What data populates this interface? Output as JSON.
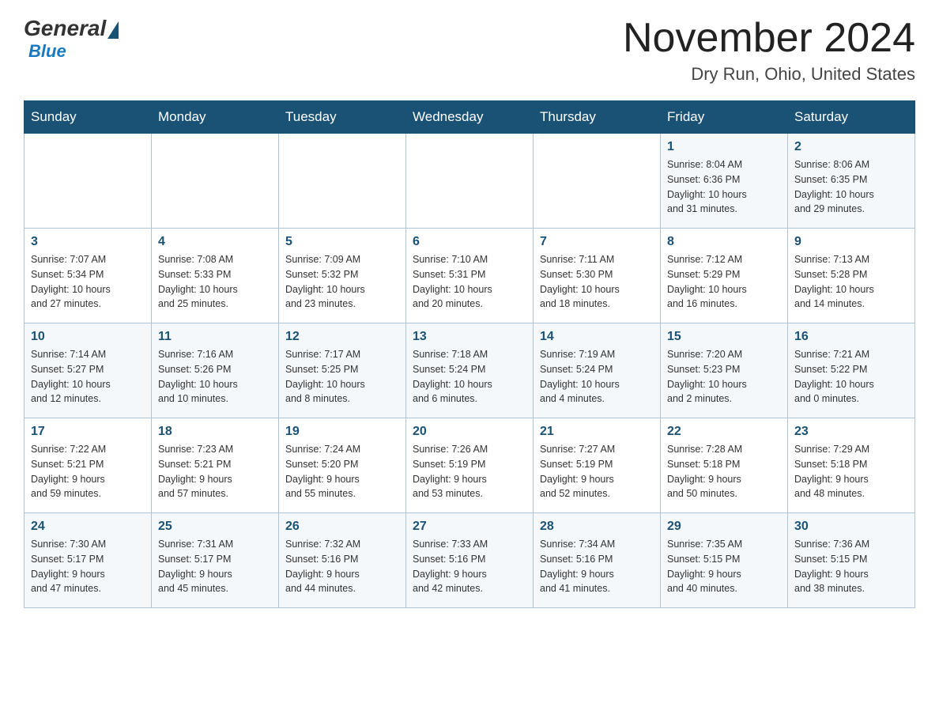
{
  "logo": {
    "general": "General",
    "blue": "Blue"
  },
  "header": {
    "title": "November 2024",
    "location": "Dry Run, Ohio, United States"
  },
  "days_of_week": [
    "Sunday",
    "Monday",
    "Tuesday",
    "Wednesday",
    "Thursday",
    "Friday",
    "Saturday"
  ],
  "weeks": [
    [
      {
        "day": "",
        "info": ""
      },
      {
        "day": "",
        "info": ""
      },
      {
        "day": "",
        "info": ""
      },
      {
        "day": "",
        "info": ""
      },
      {
        "day": "",
        "info": ""
      },
      {
        "day": "1",
        "info": "Sunrise: 8:04 AM\nSunset: 6:36 PM\nDaylight: 10 hours\nand 31 minutes."
      },
      {
        "day": "2",
        "info": "Sunrise: 8:06 AM\nSunset: 6:35 PM\nDaylight: 10 hours\nand 29 minutes."
      }
    ],
    [
      {
        "day": "3",
        "info": "Sunrise: 7:07 AM\nSunset: 5:34 PM\nDaylight: 10 hours\nand 27 minutes."
      },
      {
        "day": "4",
        "info": "Sunrise: 7:08 AM\nSunset: 5:33 PM\nDaylight: 10 hours\nand 25 minutes."
      },
      {
        "day": "5",
        "info": "Sunrise: 7:09 AM\nSunset: 5:32 PM\nDaylight: 10 hours\nand 23 minutes."
      },
      {
        "day": "6",
        "info": "Sunrise: 7:10 AM\nSunset: 5:31 PM\nDaylight: 10 hours\nand 20 minutes."
      },
      {
        "day": "7",
        "info": "Sunrise: 7:11 AM\nSunset: 5:30 PM\nDaylight: 10 hours\nand 18 minutes."
      },
      {
        "day": "8",
        "info": "Sunrise: 7:12 AM\nSunset: 5:29 PM\nDaylight: 10 hours\nand 16 minutes."
      },
      {
        "day": "9",
        "info": "Sunrise: 7:13 AM\nSunset: 5:28 PM\nDaylight: 10 hours\nand 14 minutes."
      }
    ],
    [
      {
        "day": "10",
        "info": "Sunrise: 7:14 AM\nSunset: 5:27 PM\nDaylight: 10 hours\nand 12 minutes."
      },
      {
        "day": "11",
        "info": "Sunrise: 7:16 AM\nSunset: 5:26 PM\nDaylight: 10 hours\nand 10 minutes."
      },
      {
        "day": "12",
        "info": "Sunrise: 7:17 AM\nSunset: 5:25 PM\nDaylight: 10 hours\nand 8 minutes."
      },
      {
        "day": "13",
        "info": "Sunrise: 7:18 AM\nSunset: 5:24 PM\nDaylight: 10 hours\nand 6 minutes."
      },
      {
        "day": "14",
        "info": "Sunrise: 7:19 AM\nSunset: 5:24 PM\nDaylight: 10 hours\nand 4 minutes."
      },
      {
        "day": "15",
        "info": "Sunrise: 7:20 AM\nSunset: 5:23 PM\nDaylight: 10 hours\nand 2 minutes."
      },
      {
        "day": "16",
        "info": "Sunrise: 7:21 AM\nSunset: 5:22 PM\nDaylight: 10 hours\nand 0 minutes."
      }
    ],
    [
      {
        "day": "17",
        "info": "Sunrise: 7:22 AM\nSunset: 5:21 PM\nDaylight: 9 hours\nand 59 minutes."
      },
      {
        "day": "18",
        "info": "Sunrise: 7:23 AM\nSunset: 5:21 PM\nDaylight: 9 hours\nand 57 minutes."
      },
      {
        "day": "19",
        "info": "Sunrise: 7:24 AM\nSunset: 5:20 PM\nDaylight: 9 hours\nand 55 minutes."
      },
      {
        "day": "20",
        "info": "Sunrise: 7:26 AM\nSunset: 5:19 PM\nDaylight: 9 hours\nand 53 minutes."
      },
      {
        "day": "21",
        "info": "Sunrise: 7:27 AM\nSunset: 5:19 PM\nDaylight: 9 hours\nand 52 minutes."
      },
      {
        "day": "22",
        "info": "Sunrise: 7:28 AM\nSunset: 5:18 PM\nDaylight: 9 hours\nand 50 minutes."
      },
      {
        "day": "23",
        "info": "Sunrise: 7:29 AM\nSunset: 5:18 PM\nDaylight: 9 hours\nand 48 minutes."
      }
    ],
    [
      {
        "day": "24",
        "info": "Sunrise: 7:30 AM\nSunset: 5:17 PM\nDaylight: 9 hours\nand 47 minutes."
      },
      {
        "day": "25",
        "info": "Sunrise: 7:31 AM\nSunset: 5:17 PM\nDaylight: 9 hours\nand 45 minutes."
      },
      {
        "day": "26",
        "info": "Sunrise: 7:32 AM\nSunset: 5:16 PM\nDaylight: 9 hours\nand 44 minutes."
      },
      {
        "day": "27",
        "info": "Sunrise: 7:33 AM\nSunset: 5:16 PM\nDaylight: 9 hours\nand 42 minutes."
      },
      {
        "day": "28",
        "info": "Sunrise: 7:34 AM\nSunset: 5:16 PM\nDaylight: 9 hours\nand 41 minutes."
      },
      {
        "day": "29",
        "info": "Sunrise: 7:35 AM\nSunset: 5:15 PM\nDaylight: 9 hours\nand 40 minutes."
      },
      {
        "day": "30",
        "info": "Sunrise: 7:36 AM\nSunset: 5:15 PM\nDaylight: 9 hours\nand 38 minutes."
      }
    ]
  ]
}
